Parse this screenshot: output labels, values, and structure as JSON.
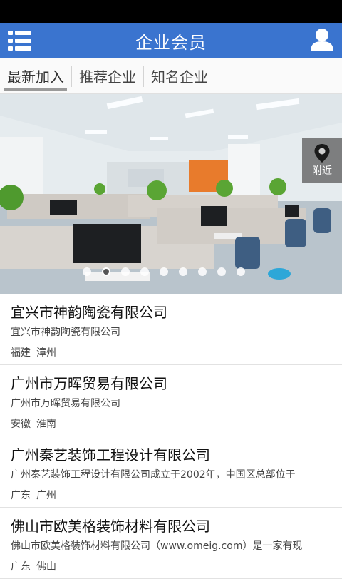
{
  "app_bar": {
    "title": "企业会员",
    "menu_icon": "menu-icon",
    "user_icon": "user-icon",
    "color": "#3a74cf"
  },
  "tabs": [
    {
      "label": "最新加入",
      "active": true
    },
    {
      "label": "推荐企业",
      "active": false
    },
    {
      "label": "知名企业",
      "active": false
    }
  ],
  "banner": {
    "nearby_label": "附近",
    "nearby_icon": "map-pin-icon",
    "dots_total": 9,
    "active_dot": 2
  },
  "companies": [
    {
      "name": "宜兴市神韵陶瓷有限公司",
      "desc": "宜兴市神韵陶瓷有限公司",
      "province": "福建",
      "city": "漳州"
    },
    {
      "name": "广州市万晖贸易有限公司",
      "desc": "广州市万晖贸易有限公司",
      "province": "安徽",
      "city": "淮南"
    },
    {
      "name": "广州秦艺装饰工程设计有限公司",
      "desc": "广州秦艺装饰工程设计有限公司成立于2002年，中国区总部位于",
      "province": "广东",
      "city": "广州"
    },
    {
      "name": "佛山市欧美格装饰材料有限公司",
      "desc": "佛山市欧美格装饰材料有限公司（www.omeig.com）是一家有现",
      "province": "广东",
      "city": "佛山"
    }
  ]
}
